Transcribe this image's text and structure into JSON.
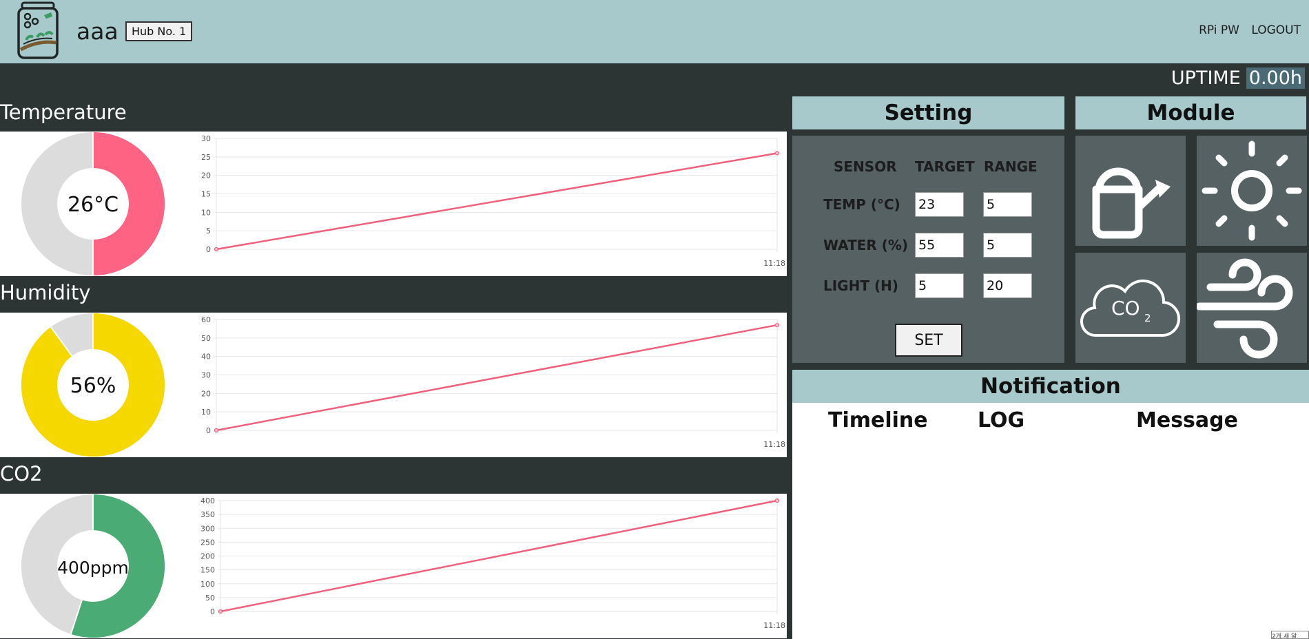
{
  "header": {
    "username": "aaa",
    "hub_label": "Hub No. 1",
    "nav": [
      "RPi PW",
      "LOGOUT"
    ]
  },
  "uptime": {
    "label": "UPTIME",
    "value": "0.00h"
  },
  "sensors": [
    {
      "title": "Temperature",
      "display": "26°C",
      "gauge_fraction": 0.5,
      "color": "#ff6384",
      "chart_data": {
        "type": "line",
        "x": [
          "",
          "11:18"
        ],
        "y": [
          0,
          26
        ],
        "ylim": [
          0,
          30
        ],
        "yticks": [
          0,
          5,
          10,
          15,
          20,
          25,
          30
        ]
      }
    },
    {
      "title": "Humidity",
      "display": "56%",
      "gauge_fraction": 0.9,
      "color": "#f5d800",
      "chart_data": {
        "type": "line",
        "x": [
          "",
          "11:18"
        ],
        "y": [
          0,
          57
        ],
        "ylim": [
          0,
          60
        ],
        "yticks": [
          0,
          10,
          20,
          30,
          40,
          50,
          60
        ]
      }
    },
    {
      "title": "CO2",
      "display": "400ppm",
      "gauge_fraction": 0.55,
      "color": "#4bab74",
      "chart_data": {
        "type": "line",
        "x": [
          "",
          "11:18"
        ],
        "y": [
          0,
          400
        ],
        "ylim": [
          0,
          400
        ],
        "yticks": [
          0,
          50,
          100,
          150,
          200,
          250,
          300,
          350,
          400
        ]
      }
    }
  ],
  "setting": {
    "title": "Setting",
    "headers": [
      "SENSOR",
      "TARGET",
      "RANGE"
    ],
    "rows": [
      {
        "label": "TEMP (°C)",
        "target": "23",
        "range": "5"
      },
      {
        "label": "WATER (%)",
        "target": "55",
        "range": "5"
      },
      {
        "label": "LIGHT (H)",
        "target": "5",
        "range": "20"
      }
    ],
    "button": "SET"
  },
  "module": {
    "title": "Module",
    "tiles": [
      "watering-can-icon",
      "sun-icon",
      "co2-cloud-icon",
      "wind-icon"
    ],
    "co2_text": "CO",
    "co2_sub": "2"
  },
  "notification": {
    "title": "Notification",
    "columns": [
      "Timeline",
      "LOG",
      "Message"
    ]
  },
  "tooltip": "2개 새 알"
}
